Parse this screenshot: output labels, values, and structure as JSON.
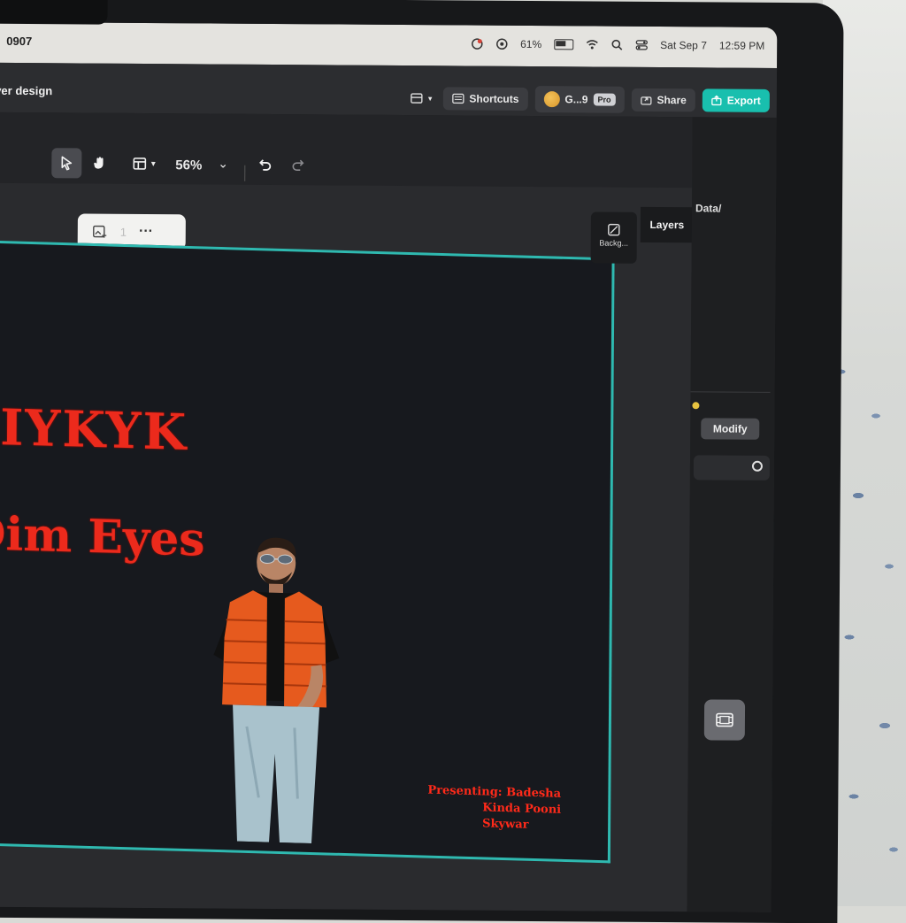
{
  "menubar": {
    "app_name": "0907",
    "battery_percent": "61%",
    "datetime_date": "Sat Sep 7",
    "datetime_time": "12:59 PM"
  },
  "titlebar": {
    "document_title": "Cover design",
    "shortcuts_label": "Shortcuts",
    "collab_label": "G...9",
    "pro_badge": "Pro",
    "share_label": "Share",
    "export_label": "Export"
  },
  "toolbar": {
    "zoom_level": "56%",
    "float_count": "1",
    "more_label": "···"
  },
  "right_panel": {
    "data_label": "Data/",
    "layers_label": "Layers",
    "background_label": "Backg...",
    "modify_label": "Modify"
  },
  "artboard": {
    "headline": "IYKYK",
    "subtitle": "Dim Eyes",
    "credit_1": "Presenting: Badesha",
    "credit_2": "Kinda Pooni",
    "credit_3": "Skywar"
  },
  "colors": {
    "accent": "#19bfae",
    "artboard_border": "#2fb9b0",
    "title_red": "#ec2a1c",
    "vest_orange": "#e65a1e"
  }
}
